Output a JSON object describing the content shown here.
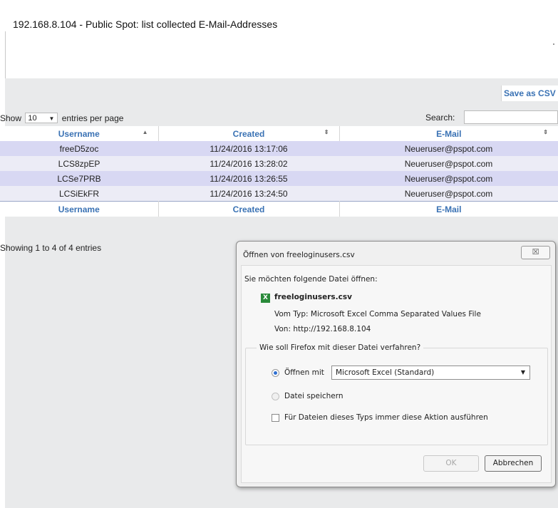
{
  "page_title": "192.168.8.104 - Public Spot: list collected E-Mail-Addresses",
  "toolbar": {
    "save_csv_label": "Save as CSV"
  },
  "length_control": {
    "prefix": "Show",
    "value": "10",
    "suffix": "entries per page"
  },
  "search": {
    "label": "Search:",
    "value": ""
  },
  "table": {
    "headers": [
      "Username",
      "Created",
      "E-Mail"
    ],
    "rows": [
      [
        "freeD5zoc",
        "11/24/2016 13:17:06",
        "Neueruser@pspot.com"
      ],
      [
        "LCS8zpEP",
        "11/24/2016 13:28:02",
        "Neueruser@pspot.com"
      ],
      [
        "LCSe7PRB",
        "11/24/2016 13:26:55",
        "Neueruser@pspot.com"
      ],
      [
        "LCSiEkFR",
        "11/24/2016 13:24:50",
        "Neueruser@pspot.com"
      ]
    ],
    "footer": [
      "Username",
      "Created",
      "E-Mail"
    ],
    "sort_icons": {
      "username": "▲",
      "created": "⇕",
      "email": "⇕"
    }
  },
  "info": "Showing 1 to 4 of 4 entries",
  "dialog": {
    "title": "Öffnen von freeloginusers.csv",
    "close_glyph": "☒",
    "question": "Sie möchten folgende Datei öffnen:",
    "file_name": "freeloginusers.csv",
    "file_type": "Vom Typ:  Microsoft Excel Comma Separated Values File",
    "file_from": "Von:  http://192.168.8.104",
    "action_legend": "Wie soll Firefox mit dieser Datei verfahren?",
    "open_with_label": "Öffnen mit",
    "open_with_app": "Microsoft Excel (Standard)",
    "save_label": "Datei speichern",
    "always_label": "Für Dateien dieses Typs immer diese Aktion ausführen",
    "ok_label": "OK",
    "cancel_label": "Abbrechen"
  }
}
